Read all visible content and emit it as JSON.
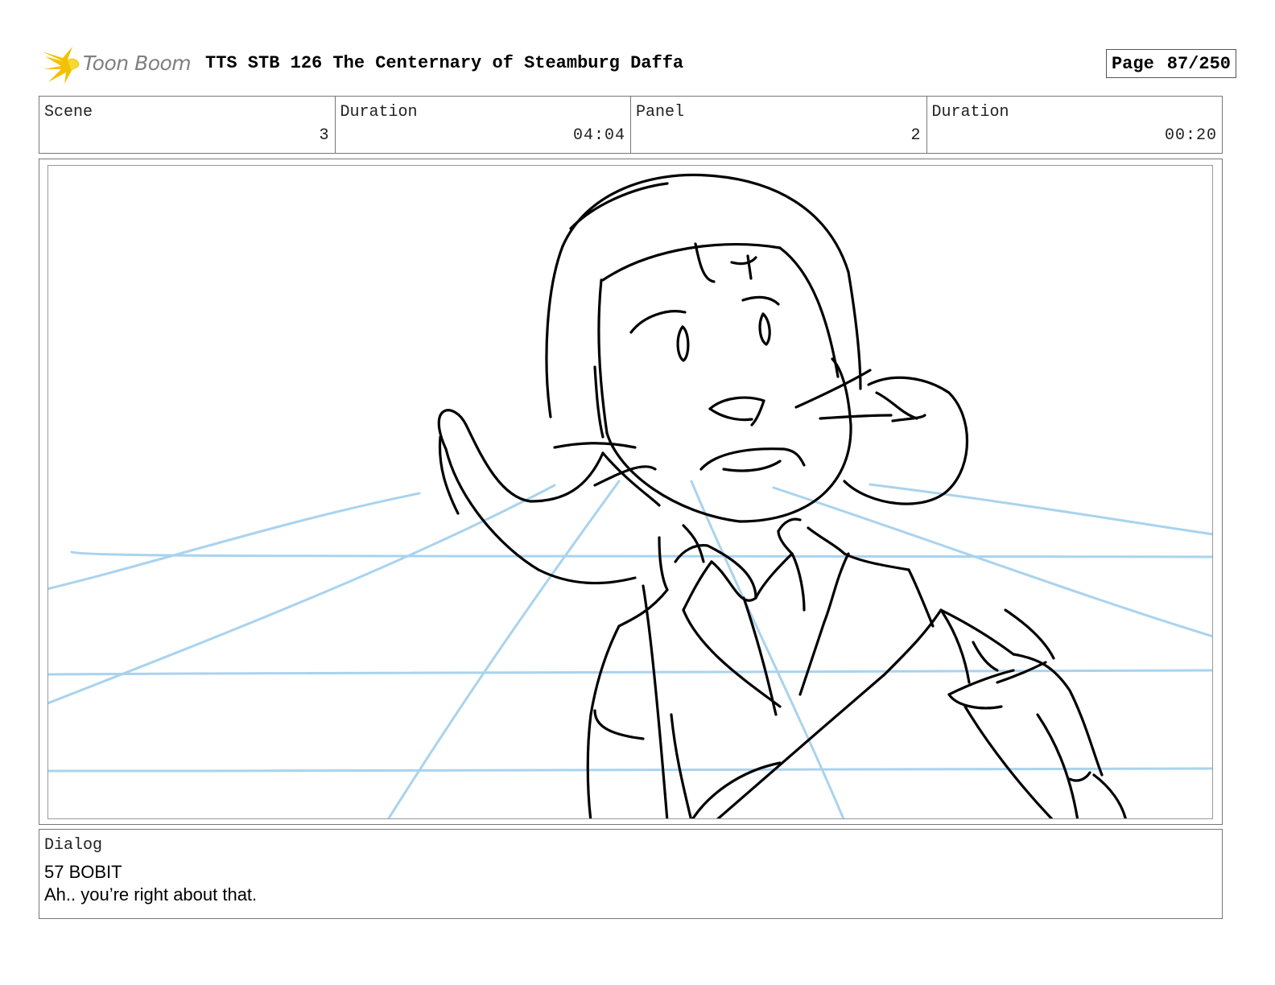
{
  "header": {
    "logo_text": "Toon Boom",
    "document_title": "TTS STB 126 The Centernary of Steamburg Daffa",
    "page_label": "Page",
    "page_number": "87/250"
  },
  "info": {
    "scene_label": "Scene",
    "scene_value": "3",
    "scene_duration_label": "Duration",
    "scene_duration_value": "04:04",
    "panel_label": "Panel",
    "panel_value": "2",
    "panel_duration_label": "Duration",
    "panel_duration_value": "00:20"
  },
  "dialog": {
    "label": "Dialog",
    "speaker": "57 BOBIT",
    "line": "Ah.. you’re right about that."
  },
  "colors": {
    "guide_lines": "#a9d3ee",
    "sketch_ink": "#000000",
    "logo_star": "#f2c200",
    "logo_text": "#7f7f7f"
  }
}
